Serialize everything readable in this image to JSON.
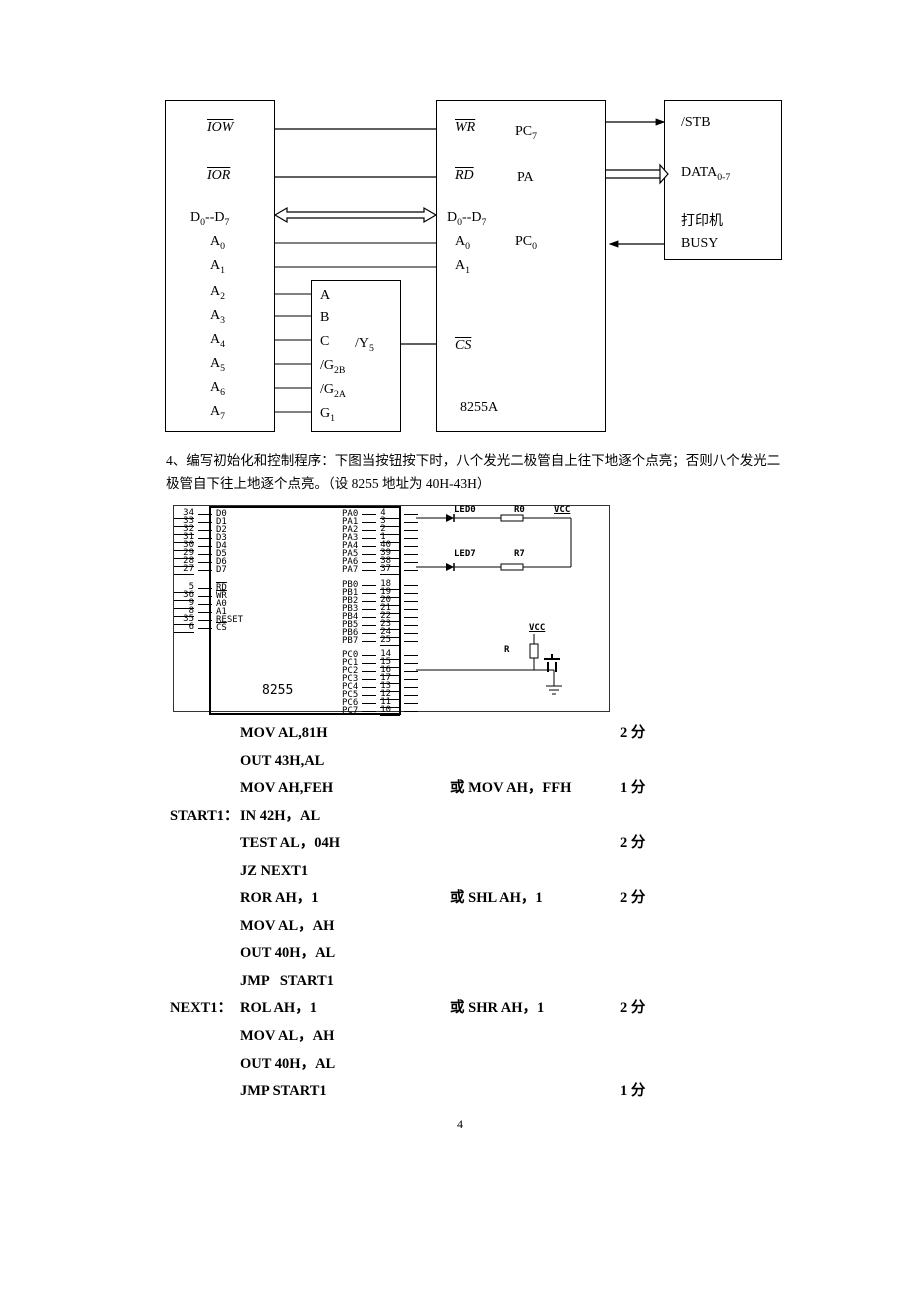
{
  "diagram1": {
    "leftBlock": {
      "row1": "IOW",
      "row2": "IOR",
      "row3_lhs": "D",
      "row3_sub1": "0",
      "row3_mid": "--D",
      "row3_sub2": "7",
      "rowsA": [
        "A",
        "A",
        "A",
        "A",
        "A",
        "A",
        "A",
        "A"
      ],
      "rowsA_sub": [
        "0",
        "1",
        "2",
        "3",
        "4",
        "5",
        "6",
        "7"
      ]
    },
    "decoder": {
      "rows": [
        "A",
        "B",
        "C",
        "/G",
        "/G",
        "G"
      ],
      "rows_sub": [
        "",
        "",
        "",
        "2B",
        "2A",
        "1"
      ],
      "y_out": "/Y",
      "y_out_sub": "5"
    },
    "chip": {
      "name": "8255A",
      "wr": "WR",
      "rd": "RD",
      "d_lhs": "D",
      "d_sub1": "0",
      "d_mid": "--D",
      "d_sub2": "7",
      "a0": "A",
      "a0_sub": "0",
      "a1": "A",
      "a1_sub": "1",
      "cs": "CS",
      "pc7": "PC",
      "pc7_sub": "7",
      "pa": "PA",
      "pc0": "PC",
      "pc0_sub": "0"
    },
    "printer": {
      "stb": "/STB",
      "data": "DATA",
      "data_sub": "0-7",
      "label": "打印机",
      "busy": "BUSY"
    }
  },
  "question": {
    "num": "4、",
    "text_a": "编写初始化和控制程序：下图当按钮按下时，八个发光二极管自上往下地逐个点亮；否则八个发光二",
    "text_b": "极管自下往上地逐个点亮。（设 8255 地址为 40H-43H）"
  },
  "chip2": {
    "name": "8255",
    "left_pins_top": [
      "34",
      "33",
      "32",
      "31",
      "30",
      "29",
      "28",
      "27"
    ],
    "left_sig_top": [
      "D0",
      "D1",
      "D2",
      "D3",
      "D4",
      "D5",
      "D6",
      "D7"
    ],
    "left_pins_bot": [
      "5",
      "36",
      "9",
      "8",
      "35",
      "6"
    ],
    "left_sig_bot": [
      "RD",
      "WR",
      "A0",
      "A1",
      "RESET",
      "CS"
    ],
    "left_over": [
      true,
      true,
      false,
      false,
      false,
      true
    ],
    "right_sig_a": [
      "PA0",
      "PA1",
      "PA2",
      "PA3",
      "PA4",
      "PA5",
      "PA6",
      "PA7"
    ],
    "right_pin_a": [
      "4",
      "3",
      "2",
      "1",
      "40",
      "39",
      "38",
      "37"
    ],
    "right_sig_b": [
      "PB0",
      "PB1",
      "PB2",
      "PB3",
      "PB4",
      "PB5",
      "PB6",
      "PB7"
    ],
    "right_pin_b": [
      "18",
      "19",
      "20",
      "21",
      "22",
      "23",
      "24",
      "25"
    ],
    "right_sig_c": [
      "PC0",
      "PC1",
      "PC2",
      "PC3",
      "PC4",
      "PC5",
      "PC6",
      "PC7"
    ],
    "right_pin_c": [
      "14",
      "15",
      "16",
      "17",
      "13",
      "12",
      "11",
      "10"
    ],
    "led0": "LED0",
    "r0": "R0",
    "vcc": "VCC",
    "led7": "LED7",
    "r7": "R7",
    "vcc2": "VCC",
    "r": "R"
  },
  "asm": [
    {
      "label": "",
      "instr": "MOV AL,81H",
      "alt": "",
      "score": "2 分"
    },
    {
      "label": "",
      "instr": "OUT 43H,AL",
      "alt": "",
      "score": ""
    },
    {
      "label": "",
      "instr": "MOV AH,FEH",
      "alt": "或 MOV AH，FFH",
      "score": "1 分"
    },
    {
      "label": "START1：",
      "instr": "IN 42H，AL",
      "alt": "",
      "score": ""
    },
    {
      "label": "",
      "instr": "TEST AL，04H",
      "alt": "",
      "score": "2 分"
    },
    {
      "label": "",
      "instr": "JZ NEXT1",
      "alt": "",
      "score": ""
    },
    {
      "label": "",
      "instr": "ROR AH，1",
      "alt": "或 SHL AH，1",
      "score": "2 分"
    },
    {
      "label": "",
      "instr": "MOV AL，AH",
      "alt": "",
      "score": ""
    },
    {
      "label": "",
      "instr": "OUT 40H，AL",
      "alt": "",
      "score": ""
    },
    {
      "label": "",
      "instr": "JMP   START1",
      "alt": "",
      "score": ""
    },
    {
      "label": "NEXT1：",
      "instr": "ROL AH，1",
      "alt": "或 SHR AH，1",
      "score": "2 分"
    },
    {
      "label": "",
      "instr": "MOV AL，AH",
      "alt": "",
      "score": ""
    },
    {
      "label": "",
      "instr": "OUT 40H，AL",
      "alt": "",
      "score": ""
    },
    {
      "label": "",
      "instr": "JMP START1",
      "alt": "",
      "score": "1 分"
    }
  ],
  "pageno": "4"
}
